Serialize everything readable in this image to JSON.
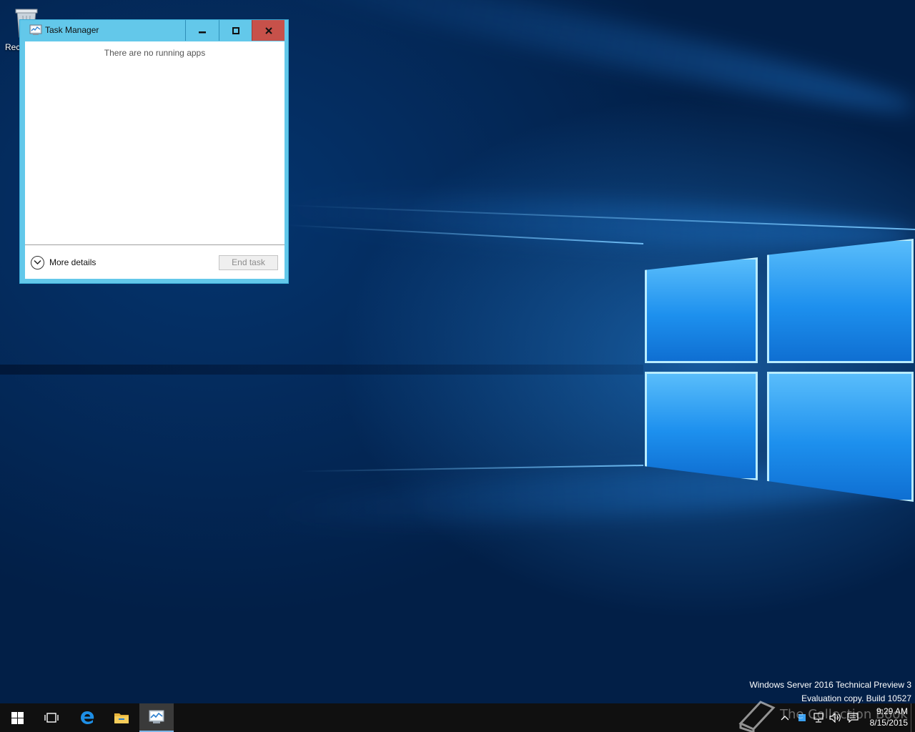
{
  "desktop": {
    "icons": [
      {
        "label": "Rec",
        "icon": "recycle-bin-icon"
      }
    ],
    "watermark": {
      "line1": "Windows Server 2016 Technical Preview 3",
      "line2": "Evaluation copy. Build 10527"
    },
    "overlay_watermark": "The Collection Book"
  },
  "task_manager": {
    "title": "Task Manager",
    "icon": "task-manager-icon",
    "controls": {
      "minimize": "minimize-icon",
      "maximize": "maximize-icon",
      "close": "close-icon"
    },
    "empty_message": "There are no running apps",
    "more_details_label": "More details",
    "end_task_label": "End task"
  },
  "taskbar": {
    "buttons": [
      {
        "name": "start",
        "icon": "windows-logo-icon"
      },
      {
        "name": "task-view",
        "icon": "task-view-icon"
      },
      {
        "name": "edge",
        "icon": "edge-browser-icon"
      },
      {
        "name": "file-explorer",
        "icon": "folder-icon"
      },
      {
        "name": "task-manager",
        "icon": "task-manager-icon",
        "active": true
      }
    ],
    "tray": [
      "chevron-up-icon",
      "network-icon",
      "volume-icon",
      "notifications-icon"
    ],
    "clock": {
      "time": "9:29 AM",
      "date": "8/15/2015"
    }
  },
  "colors": {
    "window_frame": "#63c8ea",
    "close_button": "#c7514a",
    "taskbar": "#101010",
    "wallpaper_dark": "#021f47",
    "wallpaper_light": "#1d90ee"
  }
}
